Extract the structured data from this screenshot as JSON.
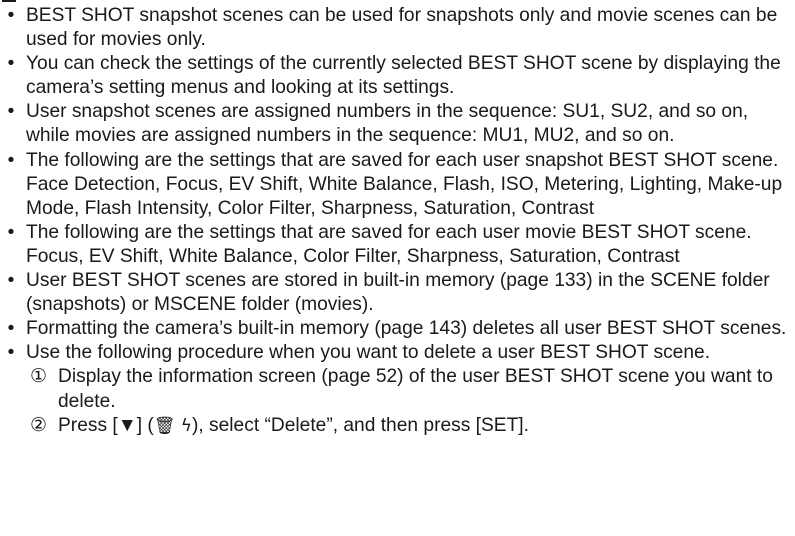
{
  "notes": [
    {
      "text": "BEST SHOT snapshot scenes can be used for snapshots only and movie scenes can be used for movies only."
    },
    {
      "text": "You can check the settings of the currently selected BEST SHOT scene by displaying the camera’s setting menus and looking at its settings."
    },
    {
      "text": "User snapshot scenes are assigned numbers in the sequence: SU1, SU2, and so on, while movies are assigned numbers in the sequence: MU1, MU2, and so on."
    },
    {
      "text": "The following are the settings that are saved for each user snapshot BEST SHOT scene.",
      "detail": "Face Detection, Focus, EV Shift, White Balance, Flash, ISO, Metering, Lighting, Make-up Mode, Flash Intensity, Color Filter, Sharpness, Saturation, Contrast"
    },
    {
      "text": "The following are the settings that are saved for each user movie BEST SHOT scene.",
      "detail": "Focus, EV Shift, White Balance, Color Filter, Sharpness, Saturation, Contrast"
    },
    {
      "text": "User BEST SHOT scenes are stored in built-in memory (page 133) in the SCENE folder (snapshots) or MSCENE folder (movies)."
    },
    {
      "text": "Formatting the camera’s built-in memory (page 143) deletes all user BEST SHOT scenes."
    },
    {
      "text": "Use the following procedure when you want to delete a user BEST SHOT scene."
    }
  ],
  "steps": [
    {
      "num": "①",
      "text": "Display the information screen (page 52) of the user BEST SHOT scene you want to delete."
    },
    {
      "num": "②",
      "text_before": "Press [▼] (",
      "icons": "🗑 ϟ",
      "text_after": "), select “Delete”, and then press [SET]."
    }
  ],
  "bullet_char": "•"
}
